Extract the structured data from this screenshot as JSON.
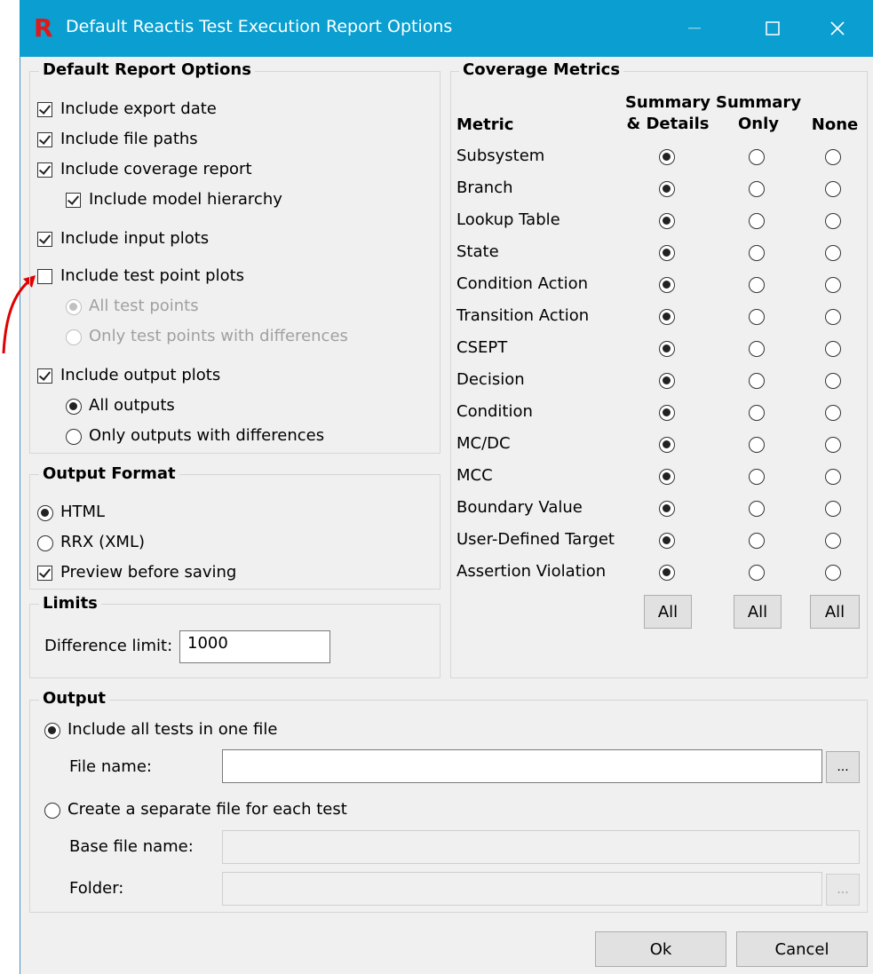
{
  "window": {
    "title": "Default Reactis Test Execution Report Options",
    "logo": "R"
  },
  "report_options": {
    "legend": "Default Report Options",
    "include_export_date": "Include export date",
    "include_file_paths": "Include file paths",
    "include_coverage_report": "Include coverage report",
    "include_model_hierarchy": "Include model hierarchy",
    "include_input_plots": "Include input plots",
    "include_test_point_plots": "Include test point plots",
    "all_test_points": "All test points",
    "only_test_points_diff": "Only test points with differences",
    "include_output_plots": "Include output plots",
    "all_outputs": "All outputs",
    "only_outputs_diff": "Only outputs with differences"
  },
  "output_format": {
    "legend": "Output Format",
    "html": "HTML",
    "rrx": "RRX (XML)",
    "preview": "Preview before saving"
  },
  "limits": {
    "legend": "Limits",
    "difference_label": "Difference limit:",
    "difference_value": "1000"
  },
  "coverage": {
    "legend": "Coverage Metrics",
    "col_metric": "Metric",
    "col_summary_details_1": "Summary",
    "col_summary_details_2": "& Details",
    "col_summary_only_1": "Summary",
    "col_summary_only_2": "Only",
    "col_none": "None",
    "metrics": [
      "Subsystem",
      "Branch",
      "Lookup Table",
      "State",
      "Condition Action",
      "Transition Action",
      "CSEPT",
      "Decision",
      "Condition",
      "MC/DC",
      "MCC",
      "Boundary Value",
      "User-Defined Target",
      "Assertion Violation"
    ],
    "all_button": "All"
  },
  "output": {
    "legend": "Output",
    "one_file": "Include all tests in one file",
    "file_name_label": "File name:",
    "separate_file": "Create a separate file for each test",
    "base_file_label": "Base file name:",
    "folder_label": "Folder:",
    "browse": "..."
  },
  "footer": {
    "ok": "Ok",
    "cancel": "Cancel"
  },
  "colors": {
    "titlebar": "#0a9fd0",
    "logo": "#e01818",
    "annotation_arrow": "#e00000"
  }
}
